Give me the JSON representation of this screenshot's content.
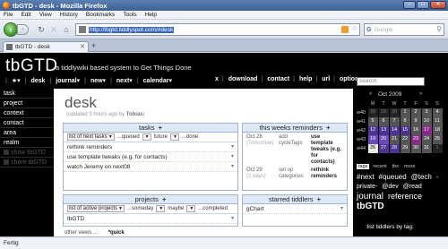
{
  "window": {
    "title": "tbGTD - desk - Mozilla Firefox"
  },
  "menu": [
    "File",
    "Edit",
    "View",
    "History",
    "Bookmarks",
    "Tools",
    "Help"
  ],
  "nav": {
    "url": "http://tbgtd.tiddlyspot.com/#desk",
    "search_placeholder": "Google",
    "search_engine_icon": "G"
  },
  "tab": {
    "label": "tbGTD - desk"
  },
  "site": {
    "title": "tbGTD",
    "subtitle": "a tiddlywiki based system to Get Things Done"
  },
  "topmenu": {
    "left": [
      "|",
      "★▾",
      "|",
      "desk",
      "|",
      "journal▾",
      "|",
      "new▾",
      "|",
      "next▾",
      "|",
      "calendar▾"
    ],
    "right": [
      "x",
      "|",
      "download",
      "|",
      "contact",
      "|",
      "help",
      "|",
      "url",
      "|",
      "options"
    ],
    "search_value": "search"
  },
  "sidebar": {
    "items": [
      "task",
      "project",
      "context",
      "contact",
      "area",
      "realm"
    ],
    "faded": [
      "show tbGTD",
      "share tbGTD"
    ]
  },
  "tiddler": {
    "title": "desk",
    "updated": "(updated 5 hours ago by",
    "author": "Tobias",
    "close": ")"
  },
  "tasks": {
    "header": "tasks",
    "plus": "+",
    "filters": [
      "list of next tasks",
      "...queued",
      "future",
      "...done"
    ],
    "rows": [
      "rethink reminders",
      "use template tweaks (e.g. for contacts)",
      "watch Jeremy on next08"
    ]
  },
  "reminders": {
    "header": "this weeks reminders",
    "plus": "+",
    "items": [
      {
        "date": "Oct 28",
        "when": "(Tomorrow)",
        "action": "add cycleTags",
        "what": "use template tweaks (e.g. for contacts)"
      },
      {
        "date": "Oct 29",
        "when": "(2 days)",
        "action": "set up categories",
        "what": "rethink reminders"
      }
    ]
  },
  "projects": {
    "header": "projects",
    "plus": "+",
    "filters": [
      "list of active projects",
      "...someday",
      "maybe",
      "...completed"
    ],
    "rows": [
      "tbGTD"
    ]
  },
  "starred": {
    "header": "starred tiddlers",
    "plus": "+",
    "rows": [
      "gChart"
    ]
  },
  "footer": {
    "other_views": "other views ...",
    "quick": "*quick"
  },
  "calendar": {
    "month": "Oct 2009",
    "prev": "«",
    "next": "»",
    "days": [
      "M",
      "T",
      "W",
      "T",
      "F",
      "S",
      "S"
    ],
    "weeks": [
      {
        "wk": "w40",
        "days": [
          "28",
          "29",
          "30",
          "1",
          "2",
          "3",
          "4"
        ]
      },
      {
        "wk": "w41",
        "days": [
          "5",
          "6",
          "7",
          "8",
          "9",
          "10",
          "11"
        ]
      },
      {
        "wk": "w42",
        "days": [
          "12",
          "13",
          "14",
          "15",
          "16",
          "17",
          "18"
        ]
      },
      {
        "wk": "w43",
        "days": [
          "19",
          "20",
          "21",
          "22",
          "23",
          "24",
          "25"
        ]
      },
      {
        "wk": "w44",
        "days": [
          "26",
          "27",
          "28",
          "29",
          "30",
          "31",
          "1"
        ]
      }
    ]
  },
  "tag_tabs": [
    "tags",
    "recent",
    "tbx",
    "more"
  ],
  "tags": [
    {
      "label": "#next",
      "size": 8
    },
    {
      "label": "#queued",
      "size": 8
    },
    {
      "label": "@tech",
      "size": 8
    },
    {
      "label": "-private-",
      "size": 7
    },
    {
      "label": "@dev",
      "size": 7
    },
    {
      "label": "@read",
      "size": 7
    },
    {
      "label": "journal",
      "size": 10
    },
    {
      "label": "reference",
      "size": 9
    },
    {
      "label": "tbGTD",
      "size": 10
    }
  ],
  "tag_list_link": ":list tiddlers by tag:",
  "status": "Fertig",
  "colors": {
    "page_bg": "#000000",
    "panel_header": "#dfe8f6",
    "panel_border": "#9fb3d6",
    "calendar_purple": "#4c3490"
  }
}
